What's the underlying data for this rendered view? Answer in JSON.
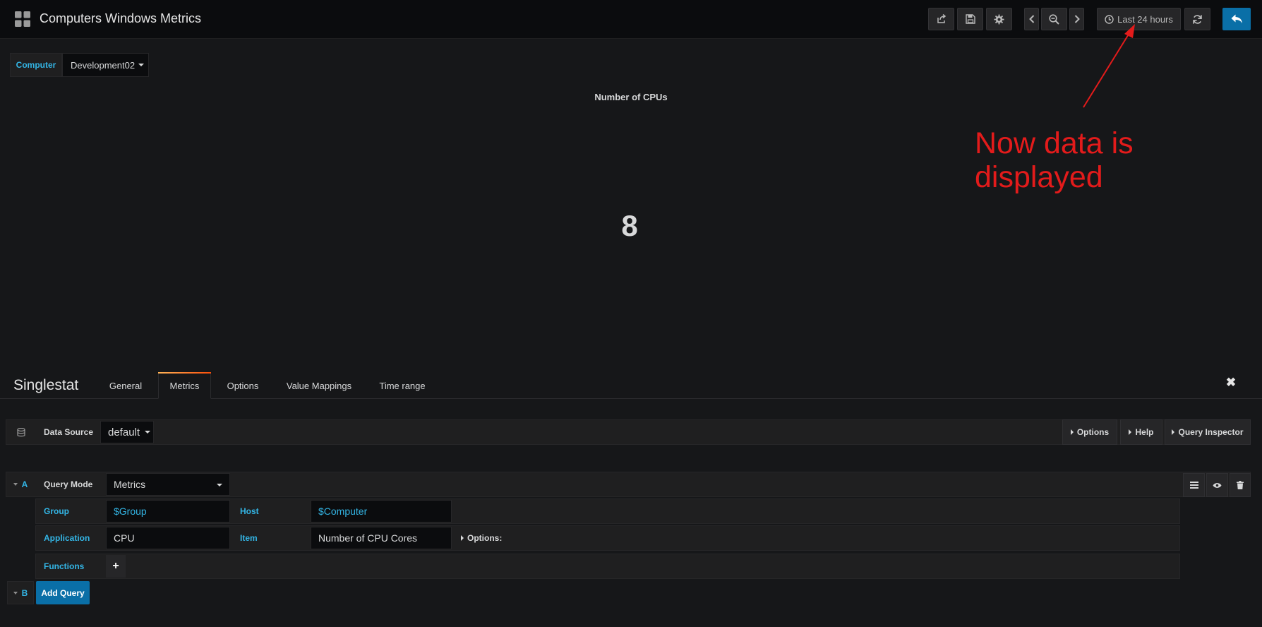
{
  "navbar": {
    "title": "Computers Windows Metrics",
    "time_range": "Last 24 hours",
    "icons": [
      "grid-icon",
      "share-icon",
      "save-icon",
      "gear-icon",
      "chevron-left-icon",
      "zoom-out-icon",
      "chevron-right-icon",
      "clock-icon",
      "refresh-icon",
      "back-arrow-icon"
    ]
  },
  "variables": {
    "computer_label": "Computer",
    "computer_value": "Development02"
  },
  "panel": {
    "title": "Number of CPUs",
    "value": "8"
  },
  "annotation": {
    "text": "Now data is displayed",
    "color": "#e31b1b"
  },
  "editor": {
    "title": "Singlestat",
    "tabs": [
      "General",
      "Metrics",
      "Options",
      "Value Mappings",
      "Time range"
    ],
    "active_tab": "Metrics",
    "close_icon": "✖"
  },
  "datasource": {
    "label": "Data Source",
    "value": "default",
    "options_label": "Options",
    "help_label": "Help",
    "inspector_label": "Query Inspector"
  },
  "query_a": {
    "ref_id": "A",
    "mode_label": "Query Mode",
    "mode_value": "Metrics",
    "group_label": "Group",
    "group_value": "$Group",
    "host_label": "Host",
    "host_value": "$Computer",
    "application_label": "Application",
    "application_value": "CPU",
    "item_label": "Item",
    "item_value": "Number of CPU Cores",
    "options_label": "Options:",
    "functions_label": "Functions",
    "add_function": "+"
  },
  "query_b": {
    "ref_id": "B",
    "add_query_label": "Add Query"
  },
  "colors": {
    "background": "#161719",
    "accent_blue": "#33b5e5",
    "primary_button": "#0a6fa7",
    "active_tab_border": "#eb7b18"
  }
}
